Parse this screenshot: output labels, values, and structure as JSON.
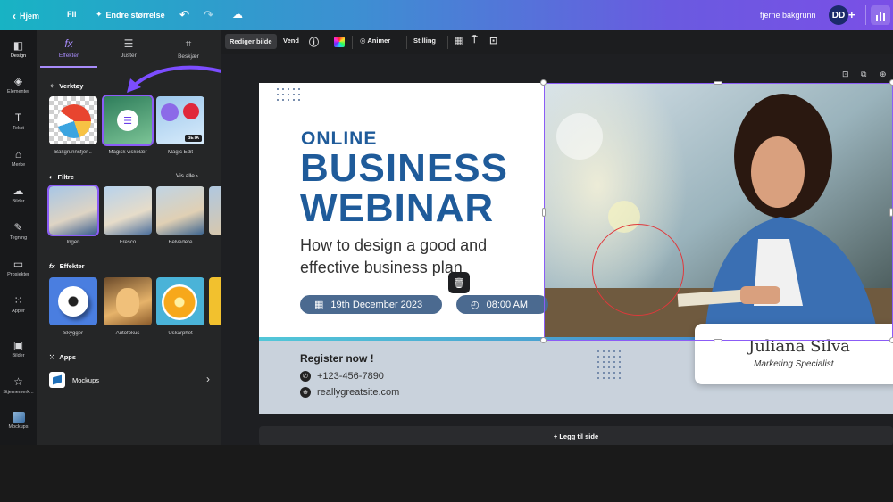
{
  "topbar": {
    "home_label": "Hjem",
    "file_label": "Fil",
    "resize_label": "Endre størrelse",
    "remove_bg_label": "fjerne bakgrunn",
    "avatar_initials": "DD"
  },
  "rail": {
    "items": [
      {
        "label": "Design"
      },
      {
        "label": "Elementer"
      },
      {
        "label": "Tekst"
      },
      {
        "label": "Merke"
      },
      {
        "label": "Bilder"
      },
      {
        "label": "Tegning"
      },
      {
        "label": "Prosjekter"
      },
      {
        "label": "Apper"
      },
      {
        "label": "Bilder"
      },
      {
        "label": "Stjernemerk..."
      },
      {
        "label": "Mockups"
      }
    ]
  },
  "panel": {
    "tabs": [
      {
        "label": "Effekter"
      },
      {
        "label": "Juster"
      },
      {
        "label": "Beskjær"
      }
    ],
    "tools": {
      "title": "Verktøy",
      "items": [
        {
          "label": "Bakgrunnsfjer..."
        },
        {
          "label": "Magisk viskelær"
        },
        {
          "label": "Magic Edit",
          "badge": "BETA"
        }
      ]
    },
    "filters": {
      "title": "Filtre",
      "see_all": "Vis alle",
      "items": [
        {
          "label": "Ingen"
        },
        {
          "label": "Fresco"
        },
        {
          "label": "Belvedere"
        }
      ]
    },
    "effects": {
      "title": "Effekter",
      "items": [
        {
          "label": "Skygger"
        },
        {
          "label": "Autofokus"
        },
        {
          "label": "Uskarphet"
        }
      ]
    },
    "apps": {
      "title": "Apps",
      "items": [
        {
          "label": "Mockups"
        }
      ]
    }
  },
  "editor_toolbar": {
    "edit_image": "Rediger bilde",
    "flip": "Vend",
    "animate": "Animer",
    "position": "Stilling"
  },
  "slide": {
    "online": "ONLINE",
    "business": "BUSINESS",
    "webinar": "WEBINAR",
    "subtitle": "How to design a good and effective business plan",
    "date": "19th December 2023",
    "time": "08:00 AM",
    "register": "Register now !",
    "phone": "+123-456-7890",
    "website": "reallygreatsite.com",
    "speaker_name": "Juliana Silva",
    "speaker_role": "Marketing Specialist"
  },
  "add_page_label": "+ Legg til side",
  "colors": {
    "accent": "#8b5cf6",
    "title_blue": "#1f5b9a",
    "pill": "#4b6a90",
    "highlight_circle": "#e0383b"
  }
}
